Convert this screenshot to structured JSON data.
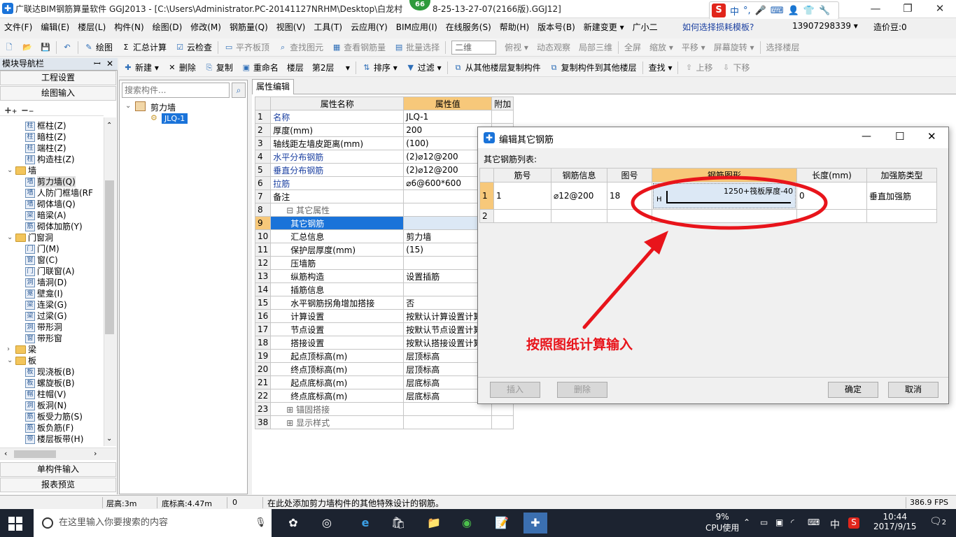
{
  "window": {
    "title": "广联达BIM钢筋算量软件 GGJ2013 - [C:\\Users\\Administrator.PC-20141127NRHM\\Desktop\\白龙村",
    "title_tail": "8-25-13-27-07(2166版).GGJ12]",
    "badge": "66",
    "min": "—",
    "max": "❐",
    "close": "✕"
  },
  "ime": {
    "logo": "S",
    "lang": "中",
    "punct": "°,"
  },
  "menu": {
    "items": [
      "文件(F)",
      "编辑(E)",
      "楼层(L)",
      "构件(N)",
      "绘图(D)",
      "修改(M)",
      "钢筋量(Q)",
      "视图(V)",
      "工具(T)",
      "云应用(Y)",
      "BIM应用(I)",
      "在线服务(S)",
      "帮助(H)",
      "版本号(B)",
      "新建变更 ▾",
      "广小二"
    ],
    "link": "如何选择损耗模板?",
    "phone": "13907298339 ▾",
    "coins": "造价豆:0"
  },
  "toolbar1": {
    "items": [
      "绘图",
      "汇总计算",
      "云检查",
      "平齐板顶",
      "查找图元",
      "查看钢筋量",
      "批量选择"
    ],
    "view_combo": "二维",
    "items2": [
      "俯视 ▾",
      "动态观察",
      "局部三维",
      "全屏",
      "缩放 ▾",
      "平移 ▾",
      "屏幕旋转 ▾",
      "选择楼层"
    ]
  },
  "toolbar2": {
    "new": "新建 ▾",
    "delete": "删除",
    "copy": "复制",
    "rename": "重命名",
    "floor_label": "楼层",
    "floor_value": "第2层",
    "sort": "排序 ▾",
    "filter": "过滤 ▾",
    "copy_from": "从其他楼层复制构件",
    "copy_to": "复制构件到其他楼层",
    "find": "查找 ▾",
    "up": "上移",
    "down": "下移"
  },
  "nav": {
    "header": "模块导航栏",
    "pin": "ꟷ",
    "close": "✕",
    "project_settings": "工程设置",
    "draw_input": "绘图输入",
    "single_input": "单构件输入",
    "report_preview": "报表预览",
    "tree": [
      {
        "label": "框柱(Z)",
        "indent": 2,
        "icon": "柱"
      },
      {
        "label": "暗柱(Z)",
        "indent": 2,
        "icon": "柱"
      },
      {
        "label": "端柱(Z)",
        "indent": 2,
        "icon": "柱"
      },
      {
        "label": "构造柱(Z)",
        "indent": 2,
        "icon": "柱"
      },
      {
        "label": "墙",
        "indent": 0,
        "folder": true,
        "exp": "⌄"
      },
      {
        "label": "剪力墙(Q)",
        "indent": 2,
        "icon": "墙",
        "selected": true
      },
      {
        "label": "人防门框墙(RF",
        "indent": 2,
        "icon": "墙"
      },
      {
        "label": "砌体墙(Q)",
        "indent": 2,
        "icon": "墙"
      },
      {
        "label": "暗梁(A)",
        "indent": 2,
        "icon": "梁"
      },
      {
        "label": "砌体加筋(Y)",
        "indent": 2,
        "icon": "筋"
      },
      {
        "label": "门窗洞",
        "indent": 0,
        "folder": true,
        "exp": "⌄"
      },
      {
        "label": "门(M)",
        "indent": 2,
        "icon": "门"
      },
      {
        "label": "窗(C)",
        "indent": 2,
        "icon": "窗"
      },
      {
        "label": "门联窗(A)",
        "indent": 2,
        "icon": "门"
      },
      {
        "label": "墙洞(D)",
        "indent": 2,
        "icon": "洞"
      },
      {
        "label": "壁龛(I)",
        "indent": 2,
        "icon": "龛"
      },
      {
        "label": "连梁(G)",
        "indent": 2,
        "icon": "梁"
      },
      {
        "label": "过梁(G)",
        "indent": 2,
        "icon": "梁"
      },
      {
        "label": "带形洞",
        "indent": 2,
        "icon": "洞"
      },
      {
        "label": "带形窗",
        "indent": 2,
        "icon": "窗"
      },
      {
        "label": "梁",
        "indent": 0,
        "folder": true,
        "exp": "›"
      },
      {
        "label": "板",
        "indent": 0,
        "folder": true,
        "exp": "⌄"
      },
      {
        "label": "现浇板(B)",
        "indent": 2,
        "icon": "板"
      },
      {
        "label": "螺旋板(B)",
        "indent": 2,
        "icon": "板"
      },
      {
        "label": "柱帽(V)",
        "indent": 2,
        "icon": "帽"
      },
      {
        "label": "板洞(N)",
        "indent": 2,
        "icon": "洞"
      },
      {
        "label": "板受力筋(S)",
        "indent": 2,
        "icon": "筋"
      },
      {
        "label": "板负筋(F)",
        "indent": 2,
        "icon": "筋"
      },
      {
        "label": "楼层板带(H)",
        "indent": 2,
        "icon": "带"
      }
    ]
  },
  "comp": {
    "search_placeholder": "搜索构件...",
    "root": "剪力墙",
    "child": "JLQ-1"
  },
  "props": {
    "tab": "属性编辑",
    "headers": [
      "属性名称",
      "属性值",
      "附加"
    ],
    "rows": [
      {
        "n": "1",
        "name": "名称",
        "value": "JLQ-1",
        "style": "blue"
      },
      {
        "n": "2",
        "name": "厚度(mm)",
        "value": "200",
        "style": ""
      },
      {
        "n": "3",
        "name": "轴线距左墙皮距离(mm)",
        "value": "(100)",
        "style": ""
      },
      {
        "n": "4",
        "name": "水平分布钢筋",
        "value": "(2)⌀12@200",
        "style": "blue"
      },
      {
        "n": "5",
        "name": "垂直分布钢筋",
        "value": "(2)⌀12@200",
        "style": "blue"
      },
      {
        "n": "6",
        "name": "拉筋",
        "value": "⌀6@600*600",
        "style": "blue"
      },
      {
        "n": "7",
        "name": "备注",
        "value": "",
        "style": ""
      },
      {
        "n": "8",
        "name": "⊟ 其它属性",
        "value": "",
        "style": "gray"
      },
      {
        "n": "9",
        "name": "── 其它钢筋",
        "value": "",
        "style": "sel"
      },
      {
        "n": "10",
        "name": "── 汇总信息",
        "value": "剪力墙",
        "style": ""
      },
      {
        "n": "11",
        "name": "── 保护层厚度(mm)",
        "value": "(15)",
        "style": ""
      },
      {
        "n": "12",
        "name": "── 压墙筋",
        "value": "",
        "style": ""
      },
      {
        "n": "13",
        "name": "── 纵筋构造",
        "value": "设置插筋",
        "style": ""
      },
      {
        "n": "14",
        "name": "── 插筋信息",
        "value": "",
        "style": ""
      },
      {
        "n": "15",
        "name": "── 水平钢筋拐角增加搭接",
        "value": "否",
        "style": ""
      },
      {
        "n": "16",
        "name": "── 计算设置",
        "value": "按默认计算设置计算",
        "style": ""
      },
      {
        "n": "17",
        "name": "── 节点设置",
        "value": "按默认节点设置计算",
        "style": ""
      },
      {
        "n": "18",
        "name": "── 搭接设置",
        "value": "按默认搭接设置计算",
        "style": ""
      },
      {
        "n": "19",
        "name": "── 起点顶标高(m)",
        "value": "层顶标高",
        "style": ""
      },
      {
        "n": "20",
        "name": "── 终点顶标高(m)",
        "value": "层顶标高",
        "style": ""
      },
      {
        "n": "21",
        "name": "── 起点底标高(m)",
        "value": "层底标高",
        "style": ""
      },
      {
        "n": "22",
        "name": "── 终点底标高(m)",
        "value": "层底标高",
        "style": ""
      },
      {
        "n": "23",
        "name": "⊞ 锚固搭接",
        "value": "",
        "style": "gray"
      },
      {
        "n": "38",
        "name": "⊞ 显示样式",
        "value": "",
        "style": "gray"
      }
    ]
  },
  "dialog": {
    "title": "编辑其它钢筋",
    "list_label": "其它钢筋列表:",
    "headers": [
      "筋号",
      "钢筋信息",
      "图号",
      "钢筋图形",
      "长度(mm)",
      "加强筋类型"
    ],
    "rows": [
      {
        "n": "1",
        "no": "1",
        "info": "⌀12@200",
        "fig": "18",
        "shape_text": "1250+筏板厚度-40",
        "shape_h": "H",
        "length": "0",
        "type": "垂直加强筋"
      },
      {
        "n": "2",
        "no": "",
        "info": "",
        "fig": "",
        "shape_text": "",
        "shape_h": "",
        "length": "",
        "type": ""
      }
    ],
    "insert": "插入",
    "delete": "删除",
    "ok": "确定",
    "cancel": "取消",
    "minimize": "—",
    "maximize": "☐",
    "close": "✕"
  },
  "annotation": {
    "text": "按照图纸计算输入",
    "color": "#e8141b"
  },
  "status": {
    "floor_height": "层高:3m",
    "base_height": "底标高:4.47m",
    "zero": "0",
    "hint": "在此处添加剪力墙构件的其他特殊设计的钢筋。",
    "fps": "386.9 FPS"
  },
  "taskbar": {
    "search": "在这里输入你要搜索的内容",
    "cpu_pct": "9%",
    "cpu_label": "CPU使用",
    "ime": "中",
    "time": "10:44",
    "date": "2017/9/15",
    "notif": "2"
  },
  "colors": {
    "accent": "#1a73d9",
    "header_hl": "#f7c87a",
    "annotation": "#e8141b"
  }
}
